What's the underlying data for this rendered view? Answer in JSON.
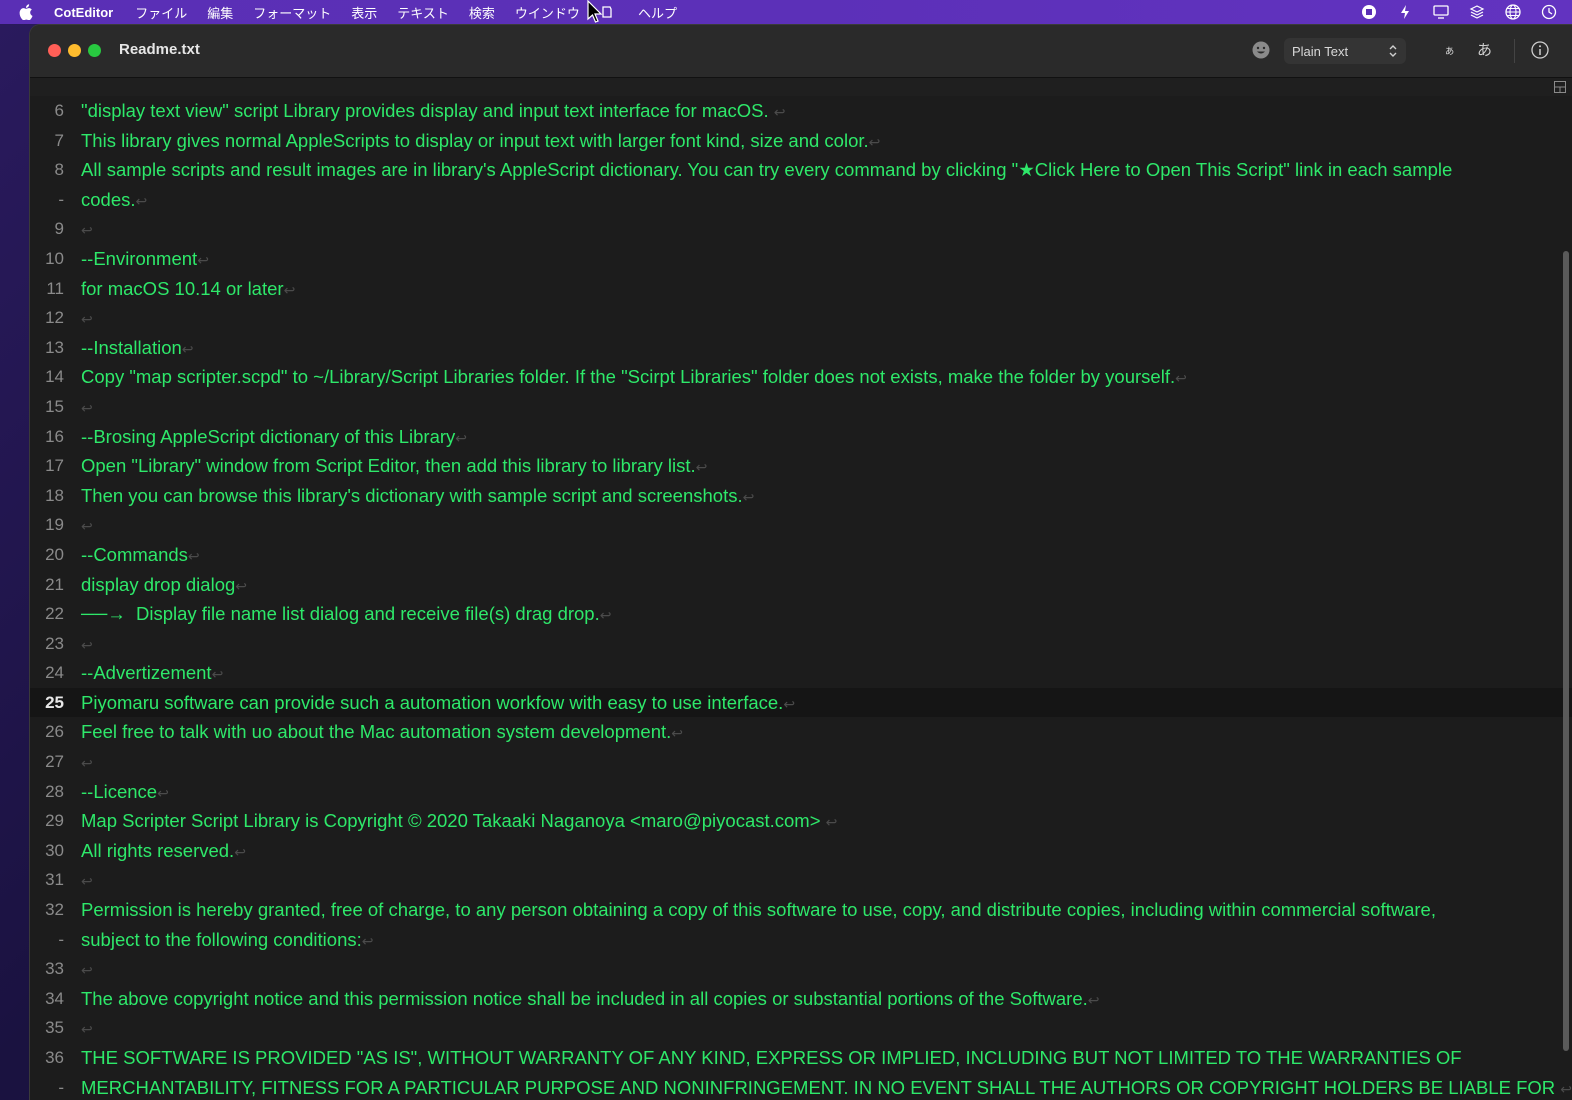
{
  "menubar": {
    "app_name": "CotEditor",
    "items": [
      "ファイル",
      "編集",
      "フォーマット",
      "表示",
      "テキスト",
      "検索",
      "ウインドウ",
      "スクリプト",
      "ヘルプ"
    ],
    "status_icons": [
      "screen-record-icon",
      "script-bolt-icon",
      "display-icon",
      "layers-icon",
      "globe-icon",
      "clock-icon"
    ]
  },
  "window": {
    "title": "Readme.txt",
    "syntax": "Plain Text",
    "kana_small": "ぁ",
    "kana_large": "あ"
  },
  "editor": {
    "current_line": "25",
    "colors": {
      "text": "#2ee86a",
      "invisibles": "#4b4b4b",
      "line_numbers": "#8a8a8a"
    },
    "rows": [
      {
        "num": "6",
        "text": "\"display text view\" script Library provides display and input text interface for macOS. "
      },
      {
        "num": "7",
        "text": "This library gives normal AppleScripts to display or input text with larger font kind, size and color."
      },
      {
        "num": "8",
        "text": "All sample scripts and result images are in library's AppleScript dictionary. You can try every command by clicking \"★Click Here to Open This Script\" link in each sample "
      },
      {
        "num": "-",
        "text": "codes."
      },
      {
        "num": "9",
        "text": ""
      },
      {
        "num": "10",
        "text": "--Environment"
      },
      {
        "num": "11",
        "text": "for macOS 10.14 or later"
      },
      {
        "num": "12",
        "text": ""
      },
      {
        "num": "13",
        "text": "--Installation"
      },
      {
        "num": "14",
        "text": "Copy \"map scripter.scpd\" to ~/Library/Script Libraries folder. If the \"Scirpt Libraries\" folder does not exists, make the folder by yourself."
      },
      {
        "num": "15",
        "text": ""
      },
      {
        "num": "16",
        "text": "--Brosing AppleScript dictionary of this Library"
      },
      {
        "num": "17",
        "text": "Open \"Library\" window from Script Editor, then add this library to library list."
      },
      {
        "num": "18",
        "text": "Then you can browse this library's dictionary with sample script and screenshots."
      },
      {
        "num": "19",
        "text": ""
      },
      {
        "num": "20",
        "text": "--Commands"
      },
      {
        "num": "21",
        "text": "display drop dialog"
      },
      {
        "num": "22",
        "text": "──→  Display file name list dialog and receive file(s) drag drop."
      },
      {
        "num": "23",
        "text": ""
      },
      {
        "num": "24",
        "text": "--Advertizement"
      },
      {
        "num": "25",
        "text": "Piyomaru software can provide such a automation workfow with easy to use interface."
      },
      {
        "num": "26",
        "text": "Feel free to talk with uo about the Mac automation system development."
      },
      {
        "num": "27",
        "text": ""
      },
      {
        "num": "28",
        "text": "--Licence"
      },
      {
        "num": "29",
        "text": "Map Scripter Script Library is Copyright © 2020 Takaaki Naganoya <maro@piyocast.com> "
      },
      {
        "num": "30",
        "text": "All rights reserved."
      },
      {
        "num": "31",
        "text": ""
      },
      {
        "num": "32",
        "text": "Permission is hereby granted, free of charge, to any person obtaining a copy of this software to use, copy, and distribute copies, including within commercial software, "
      },
      {
        "num": "-",
        "text": "subject to the following conditions:"
      },
      {
        "num": "33",
        "text": ""
      },
      {
        "num": "34",
        "text": "The above copyright notice and this permission notice shall be included in all copies or substantial portions of the Software."
      },
      {
        "num": "35",
        "text": ""
      },
      {
        "num": "36",
        "text": "THE SOFTWARE IS PROVIDED \"AS IS\", WITHOUT WARRANTY OF ANY KIND, EXPRESS OR IMPLIED, INCLUDING BUT NOT LIMITED TO THE WARRANTIES OF "
      },
      {
        "num": "-",
        "text": "MERCHANTABILITY, FITNESS FOR A PARTICULAR PURPOSE AND NONINFRINGEMENT. IN NO EVENT SHALL THE AUTHORS OR COPYRIGHT HOLDERS BE LIABLE FOR "
      }
    ]
  }
}
